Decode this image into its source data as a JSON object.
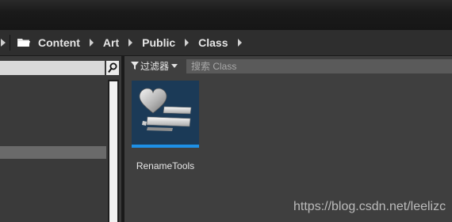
{
  "breadcrumb": {
    "items": [
      "Content",
      "Art",
      "Public",
      "Class"
    ]
  },
  "left_panel": {
    "search_value": ""
  },
  "toolbar": {
    "filters_label": "过滤器",
    "search_placeholder": "搜索 Class"
  },
  "assets": [
    {
      "name": "RenameTools",
      "icon": "heart-text-blueprint-icon"
    }
  ],
  "watermark": "https://blog.csdn.net/leelizc",
  "colors": {
    "asset_accent": "#1e90e6",
    "asset_bg": "#1b3a57"
  }
}
